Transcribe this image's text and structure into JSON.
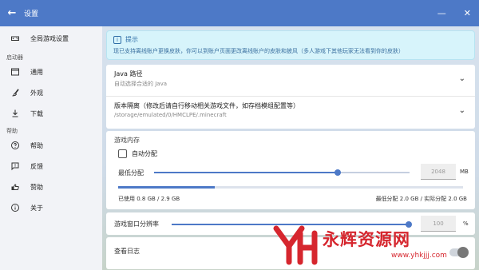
{
  "titlebar": {
    "back_icon": "arrow-left-icon",
    "title": "设置",
    "minimize_glyph": "—",
    "close_glyph": "✕"
  },
  "sidebar": {
    "items": [
      {
        "label": "全局游戏设置",
        "icon": "gamepad-icon"
      },
      {
        "label": "通用",
        "icon": "window-icon"
      },
      {
        "label": "外观",
        "icon": "brush-icon"
      },
      {
        "label": "下载",
        "icon": "download-icon"
      },
      {
        "label": "帮助",
        "icon": "help-icon"
      },
      {
        "label": "反馈",
        "icon": "feedback-icon"
      },
      {
        "label": "赞助",
        "icon": "sponsor-icon"
      },
      {
        "label": "关于",
        "icon": "info-icon"
      }
    ],
    "groups": [
      "启动器",
      "帮助"
    ]
  },
  "tip": {
    "title": "提示",
    "body": "现已支持离线账户更换皮肤，你可以到账户页面更改离线账户的皮肤和披风（多人游戏下其他玩家无法看到你的皮肤）"
  },
  "java": {
    "title": "Java 路径",
    "subtitle": "自动选择合适的 Java"
  },
  "isolation": {
    "title": "版本隔离（修改后请自行移动相关游戏文件，如存档模组配置等）",
    "subtitle": "/storage/emulated/0/HMCLPE/.minecraft"
  },
  "memory": {
    "section_title": "游戏内存",
    "auto_label": "自动分配",
    "min_label": "最低分配",
    "slider_fraction": 0.72,
    "value": "2048",
    "unit": "MB",
    "usage_fraction": 0.28,
    "used_text": "已使用 0.8 GB / 2.9 GB",
    "alloc_text": "最低分配 2.0 GB / 实际分配 2.0 GB"
  },
  "scale": {
    "label": "游戏窗口分辨率",
    "value": "100",
    "unit": "%",
    "slider_fraction": 0.99
  },
  "log": {
    "label": "查看日志"
  },
  "watermark": {
    "name": "永辉资源网",
    "url": "www.yhkjjj.com"
  },
  "colors": {
    "accent": "#4d79c7",
    "watermark": "#d6262e"
  }
}
